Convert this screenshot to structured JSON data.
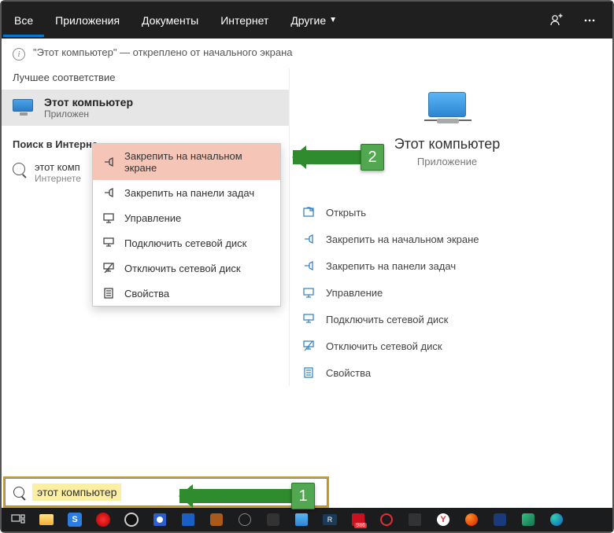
{
  "header": {
    "tabs": [
      "Все",
      "Приложения",
      "Документы",
      "Интернет",
      "Другие"
    ]
  },
  "info": "\"Этот компьютер\" — откреплено от начального экрана",
  "left": {
    "best_match_label": "Лучшее соответствие",
    "result": {
      "title": "Этот компьютер",
      "sub": "Приложен"
    },
    "web_label": "Поиск в Интерне",
    "web_result": {
      "title": "этот комп",
      "sub": "Интернете"
    }
  },
  "ctx": [
    "Закрепить на начальном экране",
    "Закрепить на панели задач",
    "Управление",
    "Подключить сетевой диск",
    "Отключить сетевой диск",
    "Свойства"
  ],
  "preview": {
    "title": "Этот компьютер",
    "sub": "Приложение"
  },
  "actions": [
    "Открыть",
    "Закрепить на начальном экране",
    "Закрепить на панели задач",
    "Управление",
    "Подключить сетевой диск",
    "Отключить сетевой диск",
    "Свойства"
  ],
  "search": "этот компьютер",
  "steps": {
    "s1": "2",
    "s2": "1"
  }
}
